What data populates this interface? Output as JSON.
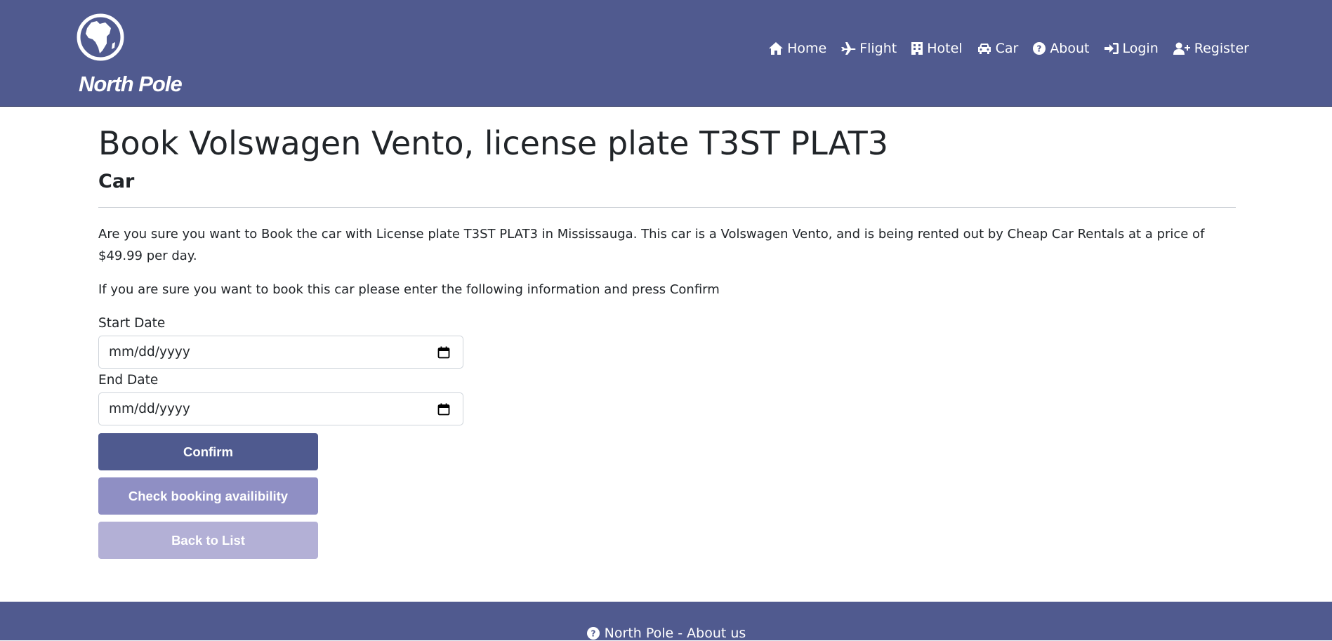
{
  "brand": {
    "name": "North Pole",
    "logo_icon": "globe-africa-icon"
  },
  "nav": {
    "items": [
      {
        "label": "Home",
        "icon": "home-icon"
      },
      {
        "label": "Flight",
        "icon": "plane-icon"
      },
      {
        "label": "Hotel",
        "icon": "hotel-icon"
      },
      {
        "label": "Car",
        "icon": "car-icon"
      },
      {
        "label": "About",
        "icon": "question-circle-icon"
      },
      {
        "label": "Login",
        "icon": "sign-in-icon"
      },
      {
        "label": "Register",
        "icon": "user-plus-icon"
      }
    ]
  },
  "page": {
    "title": "Book Volswagen Vento, license plate T3ST PLAT3",
    "subtitle": "Car",
    "description": "Are you sure you want to Book the car with License plate T3ST PLAT3 in Mississauga. This car is a Volswagen Vento, and is being rented out by Cheap Car Rentals at a price of $49.99 per day.",
    "instruction": "If you are sure you want to book this car please enter the following information and press Confirm"
  },
  "form": {
    "start_date": {
      "label": "Start Date",
      "value": "mm/dd/yyyy"
    },
    "end_date": {
      "label": "End Date",
      "value": "mm/dd/yyyy"
    },
    "confirm_label": "Confirm",
    "check_label": "Check booking availibility",
    "back_label": "Back to List"
  },
  "footer": {
    "text": "North Pole - About us",
    "icon": "question-circle-icon"
  },
  "colors": {
    "navbar": "#505a8f",
    "confirm_button": "#4f5a8f",
    "check_button": "#8f8fc4",
    "back_button": "#b3b0d6"
  }
}
